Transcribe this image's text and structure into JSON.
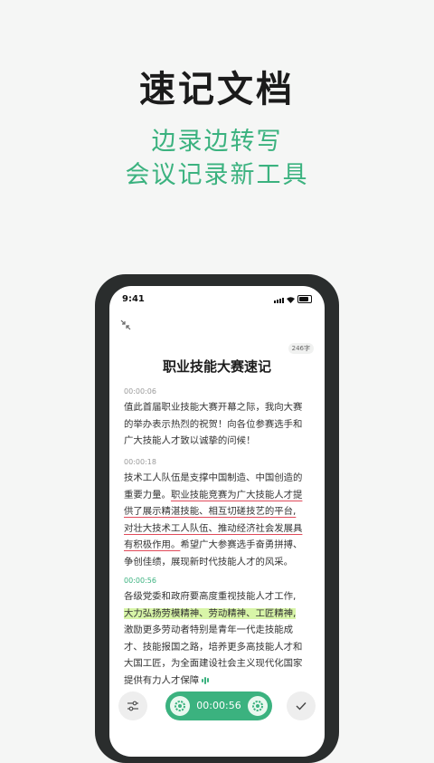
{
  "hero": {
    "title": "速记文档",
    "subtitle_line1": "边录边转写",
    "subtitle_line2": "会议记录新工具"
  },
  "status_bar": {
    "time": "9:41"
  },
  "document": {
    "word_count": "246字",
    "title": "职业技能大赛速记",
    "paragraphs": [
      {
        "timestamp": "00:00:06",
        "lines": [
          "值此首届职业技能大赛开幕之际，我向大赛",
          "的举办表示热烈的祝贺！向各位参赛选手和",
          "广大技能人才致以诚挚的问候！"
        ]
      },
      {
        "timestamp": "00:00:18",
        "lines": [
          "技术工人队伍是支撑中国制造、中国创造的"
        ],
        "line2_plain": "重要力量。",
        "line2_underlined": "职业技能竞赛为广大技能人才提",
        "underlined_lines": [
          "供了展示精湛技能、相互切磋技艺的平台,",
          "对壮大技术工人队伍、推动经济社会发展具"
        ],
        "line6_underlined": "有积极作用。",
        "line6_plain": "希望广大参赛选手奋勇拼搏、",
        "line7": "争创佳绩，展现新时代技能人才的风采。"
      },
      {
        "timestamp": "00:00:56",
        "line1": "各级党委和政府要高度重视技能人才工作,",
        "highlighted": "大力弘扬劳模精神、劳动精神、工匠精神,",
        "lines": [
          "激励更多劳动者特别是青年一代走技能成",
          "才、技能报国之路，培养更多高技能人才和",
          "大国工匠，为全面建设社会主义现代化国家"
        ],
        "last_line": "提供有力人才保障"
      }
    ]
  },
  "controls": {
    "settings_icon": "sliders-icon",
    "confirm_icon": "check-icon",
    "recording_time": "00:00:56",
    "accent_color": "#3bb27f",
    "highlight_color": "#d8f5a8",
    "underline_color": "#e04a5a"
  }
}
